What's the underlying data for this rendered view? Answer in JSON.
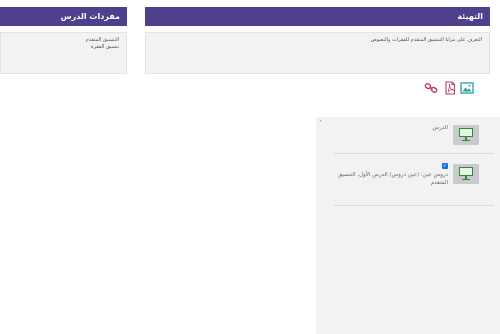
{
  "intro_panel": {
    "title": "التهيئة",
    "body": "التعرف على مزايا التنسيق المتقدم للفقرات والنصوص"
  },
  "vocab_panel": {
    "title": "مفردات الدرس",
    "items": [
      "التنسيق المتقدم",
      "تنسيق الفقرة"
    ]
  },
  "toolbar": {
    "icons": [
      "image-icon",
      "pdf-icon",
      "link-icon"
    ]
  },
  "lesson_list": {
    "collapse_symbol": "˄",
    "items": [
      {
        "label": "الدرس",
        "checked": false
      },
      {
        "label": "دروس عين: (عين دروس) الدرس الأول، التنسيق المتقدم",
        "checked": true
      }
    ]
  },
  "colors": {
    "header_bg": "#4f3f8c",
    "accent_pink": "#c0396b",
    "accent_teal": "#2c9aa6",
    "monitor_green": "#2f8a3a"
  }
}
